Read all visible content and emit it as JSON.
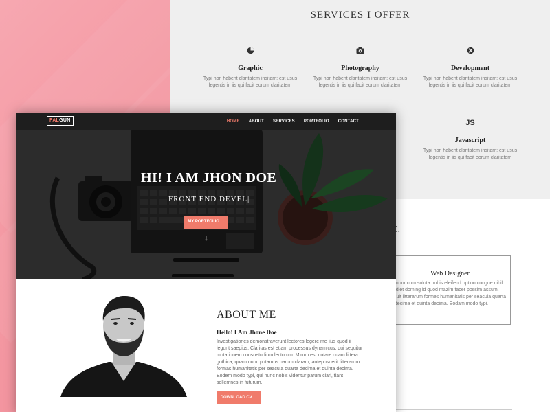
{
  "services_page": {
    "title": "SERVICES I OFFER",
    "items": [
      {
        "icon": "pie-chart-icon",
        "name": "Graphic",
        "description": "Typi non habent claritatem insitam; est usus legentis in iis qui facit eorum claritatem"
      },
      {
        "icon": "camera-icon",
        "name": "Photography",
        "description": "Typi non habent claritatem insitam; est usus legentis in iis qui facit eorum claritatem"
      },
      {
        "icon": "xbox-icon",
        "name": "Development",
        "description": "Typi non habent claritatem insitam; est usus legentis in iis qui facit eorum claritatem"
      },
      {
        "icon": "js-icon",
        "icon_text": "JS",
        "name": "Javascript",
        "description": "Typi non habent claritatem insitam; est usus legentis in iis qui facit eorum claritatem"
      }
    ],
    "partial_heading_letter": "E.",
    "web_designer": {
      "name": "Web Designer",
      "description": "liber tempor cum soluta nobis eleifend option congue nihil imperdiet doming id quod mazim facer possim assum. antepossuit litterarum formes humanitatis per seacula quarta decima et quinta decima. Eodam modo typi."
    }
  },
  "front_page": {
    "logo": {
      "accent": "FAL",
      "rest": "GUN"
    },
    "nav": [
      {
        "label": "HOME",
        "active": true
      },
      {
        "label": "ABOUT",
        "active": false
      },
      {
        "label": "SERVICES",
        "active": false
      },
      {
        "label": "PORTFOLIO",
        "active": false
      },
      {
        "label": "CONTACT",
        "active": false
      }
    ],
    "hero": {
      "title": "HI! I AM JHON DOE",
      "subtitle": "FRONT END DEVEL|",
      "button": "MY PORTFOLIO →",
      "scroll_arrow": "↓"
    },
    "about": {
      "title": "ABOUT ME",
      "greeting": "Hello! I Am Jhone Doe",
      "text": "Investigationes demonstraverunt lectores legere me lius quod ii legunt saepius. Claritas est etiam processus dynamicus, qui sequitur mutationem consuetudium lectorum. Mirum est notare quam littera gothica, quam nunc putamus parum claram, anteposuerit litterarum formas humanitatis per seacula quarta decima et quinta decima. Eodem modo typi, qui nunc nobis videntur parum clari, fiant sollemnes in futurum.",
      "button": "DOWNLOAD CV →"
    }
  },
  "colors": {
    "accent": "#f07b6b",
    "pink_background": "#f49aa4",
    "nav_background": "#1e1e1e",
    "services_background": "#efefef"
  }
}
